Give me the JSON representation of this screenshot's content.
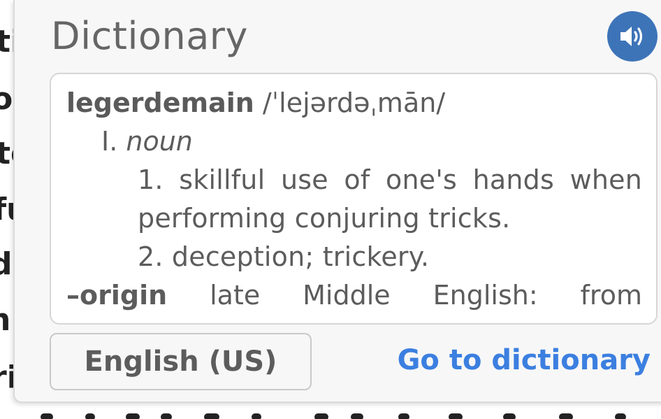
{
  "background_text": {
    "fragments": [
      "ti",
      "o",
      "te",
      "fu",
      "d",
      "n",
      "ri"
    ]
  },
  "popup": {
    "title": "Dictionary",
    "speaker_icon": "volume-speaker-icon",
    "definition": {
      "headword": "legerdemain",
      "pronunciation": "/ˈlejərdəˌmān/",
      "part_of_speech_number": "I.",
      "part_of_speech": "noun",
      "senses": [
        "1. skillful use of one's hands when performing conjuring tricks.",
        "2. deception; trickery."
      ],
      "origin_dash": "–",
      "origin_label": "origin",
      "origin_text": "late Middle English: from"
    },
    "language_button": "English (US)",
    "goto_link": "Go to dictionary"
  },
  "colors": {
    "accent_blue": "#3b7fe0",
    "speaker_bg": "#3d74b8",
    "popup_bg": "#f7f7f7"
  }
}
